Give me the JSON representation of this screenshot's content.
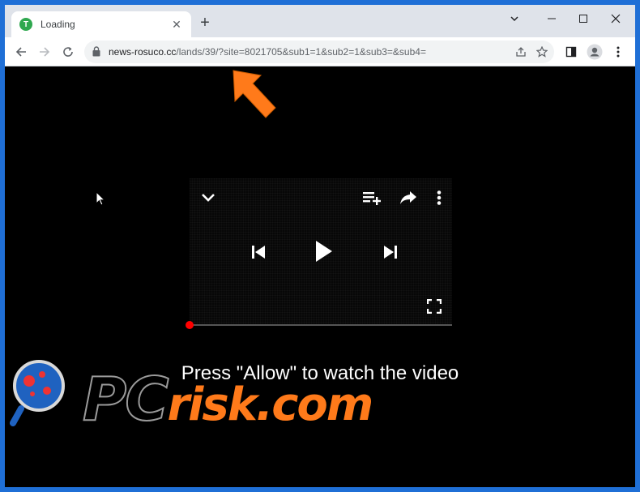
{
  "browser": {
    "tab": {
      "title": "Loading",
      "favicon_letter": "T"
    },
    "url": {
      "host": "news-rosuco.cc",
      "path": "/lands/39/?site=8021705&sub1=1&sub2=1&sub3=&sub4="
    },
    "icons": [
      "back-icon",
      "forward-icon",
      "reload-icon",
      "lock-icon",
      "share-icon",
      "star-icon",
      "sidepanel-icon",
      "profile-icon",
      "menu-icon",
      "minimize-icon",
      "maximize-icon",
      "close-icon"
    ]
  },
  "player": {
    "icons": [
      "chevron-down-icon",
      "add-to-queue-icon",
      "share-arrow-icon",
      "more-vert-icon",
      "previous-icon",
      "play-icon",
      "next-icon",
      "fullscreen-icon"
    ],
    "progress_fraction": 0.0
  },
  "page": {
    "message": "Press \"Allow\" to watch the video"
  },
  "watermark": {
    "part1": "PC",
    "part2": "risk.com"
  },
  "colors": {
    "accent_arrow": "#ff7a1a",
    "progress_dot": "#ff0000",
    "tabstrip": "#dfe3ea"
  }
}
